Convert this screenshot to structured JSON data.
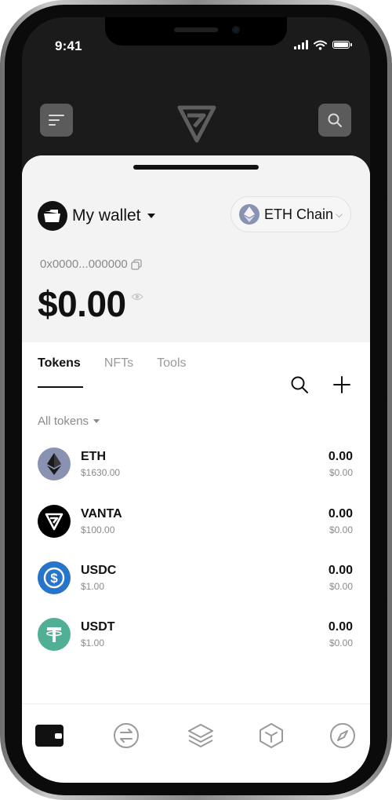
{
  "status_bar": {
    "time": "9:41"
  },
  "header": {
    "menu_icon": "menu-icon",
    "logo": "vanta-logo",
    "search_icon": "search-icon"
  },
  "wallet": {
    "name": "My wallet",
    "chain": "ETH Chain",
    "address": "0x0000...000000",
    "balance": "$0.00"
  },
  "tabs": [
    {
      "label": "Tokens",
      "active": true
    },
    {
      "label": "NFTs",
      "active": false
    },
    {
      "label": "Tools",
      "active": false
    }
  ],
  "filter": {
    "label": "All tokens"
  },
  "tokens": [
    {
      "symbol": "ETH",
      "price": "$1630.00",
      "balance": "0.00",
      "value": "$0.00",
      "icon": "eth-icon",
      "color": "#8a92b2"
    },
    {
      "symbol": "VANTA",
      "price": "$100.00",
      "balance": "0.00",
      "value": "$0.00",
      "icon": "vanta-icon",
      "color": "#000000"
    },
    {
      "symbol": "USDC",
      "price": "$1.00",
      "balance": "0.00",
      "value": "$0.00",
      "icon": "usdc-icon",
      "color": "#2775ca"
    },
    {
      "symbol": "USDT",
      "price": "$1.00",
      "balance": "0.00",
      "value": "$0.00",
      "icon": "usdt-icon",
      "color": "#50af95"
    }
  ],
  "bottom_nav": [
    {
      "icon": "wallet-icon",
      "active": true
    },
    {
      "icon": "swap-icon",
      "active": false
    },
    {
      "icon": "layers-icon",
      "active": false
    },
    {
      "icon": "cube-icon",
      "active": false
    },
    {
      "icon": "compass-icon",
      "active": false
    }
  ],
  "colors": {
    "header_bg": "#1b1b1b",
    "button_bg": "#5b5b5b",
    "text_primary": "#111111",
    "text_secondary": "#8a8a8a"
  }
}
